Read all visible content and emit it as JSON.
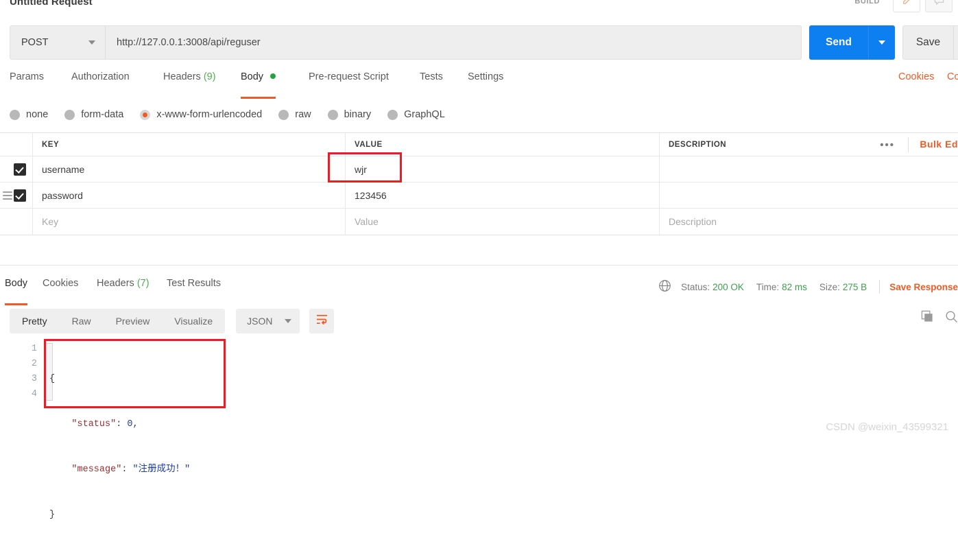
{
  "request": {
    "title": "Untitled Request",
    "build_label": "BUILD",
    "method": "POST",
    "url": "http://127.0.0.1:3008/api/reguser",
    "send_label": "Send",
    "save_label": "Save",
    "tabs": [
      {
        "label": "Params",
        "count": "",
        "active": false
      },
      {
        "label": "Authorization",
        "count": "",
        "active": false
      },
      {
        "label": "Headers",
        "count": "(9)",
        "active": false
      },
      {
        "label": "Body",
        "count": "",
        "active": true
      },
      {
        "label": "Pre-request Script",
        "count": "",
        "active": false
      },
      {
        "label": "Tests",
        "count": "",
        "active": false
      },
      {
        "label": "Settings",
        "count": "",
        "active": false
      }
    ],
    "right_links": [
      {
        "label": "Cookies"
      },
      {
        "label": "Co"
      }
    ],
    "body_types": [
      {
        "label": "none",
        "selected": false
      },
      {
        "label": "form-data",
        "selected": false
      },
      {
        "label": "x-www-form-urlencoded",
        "selected": true
      },
      {
        "label": "raw",
        "selected": false
      },
      {
        "label": "binary",
        "selected": false
      },
      {
        "label": "GraphQL",
        "selected": false
      }
    ],
    "table": {
      "headers": {
        "key": "KEY",
        "value": "VALUE",
        "description": "DESCRIPTION"
      },
      "bulk_edit_label": "Bulk Ed",
      "dots_label": "•••",
      "rows": [
        {
          "checked": true,
          "drag": false,
          "key": "username",
          "value": "wjr",
          "description": "",
          "placeholder": false
        },
        {
          "checked": true,
          "drag": true,
          "key": "password",
          "value": "123456",
          "description": "",
          "placeholder": false
        },
        {
          "checked": false,
          "drag": false,
          "key": "Key",
          "value": "Value",
          "description": "Description",
          "placeholder": true
        }
      ]
    }
  },
  "response": {
    "tabs": [
      {
        "label": "Body",
        "count": "",
        "active": true
      },
      {
        "label": "Cookies",
        "count": "",
        "active": false
      },
      {
        "label": "Headers",
        "count": "(7)",
        "active": false
      },
      {
        "label": "Test Results",
        "count": "",
        "active": false
      }
    ],
    "status": {
      "status_label": "Status:",
      "status_value": "200 OK",
      "time_label": "Time:",
      "time_value": "82 ms",
      "size_label": "Size:",
      "size_value": "275 B",
      "save_response_label": "Save Response"
    },
    "view_modes": [
      {
        "label": "Pretty",
        "active": true
      },
      {
        "label": "Raw",
        "active": false
      },
      {
        "label": "Preview",
        "active": false
      },
      {
        "label": "Visualize",
        "active": false
      }
    ],
    "format": "JSON",
    "code": {
      "line_numbers": [
        "1",
        "2",
        "3",
        "4"
      ],
      "lines": [
        {
          "indent": "",
          "tokens": [
            {
              "t": "punc",
              "v": "{"
            }
          ]
        },
        {
          "indent": "    ",
          "tokens": [
            {
              "t": "key",
              "v": "\"status\""
            },
            {
              "t": "punc",
              "v": ": "
            },
            {
              "t": "num",
              "v": "0"
            },
            {
              "t": "punc",
              "v": ","
            }
          ]
        },
        {
          "indent": "    ",
          "tokens": [
            {
              "t": "key",
              "v": "\"message\""
            },
            {
              "t": "punc",
              "v": ": "
            },
            {
              "t": "str",
              "v": "\"注册成功！\""
            }
          ]
        },
        {
          "indent": "",
          "tokens": [
            {
              "t": "punc",
              "v": "}"
            }
          ]
        }
      ]
    }
  },
  "watermark": "CSDN @weixin_43599321",
  "colors": {
    "accent_orange": "#ef5b25",
    "send_blue": "#0d7ff1",
    "status_green": "#3ba14b",
    "annotation_red": "#ed1c24"
  }
}
